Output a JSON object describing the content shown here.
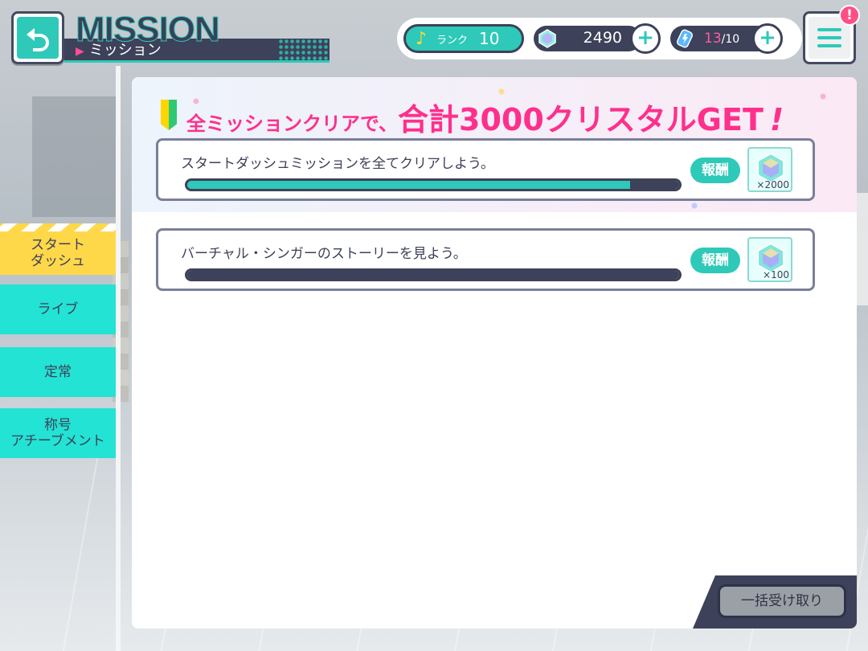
{
  "header": {
    "title": "MISSION",
    "subtitle": "ミッション",
    "back_icon": "back-arrow-icon",
    "menu_icon": "hamburger-menu-icon",
    "alert_badge": "!"
  },
  "status": {
    "rank_label": "ランク",
    "rank_value": "10",
    "crystals": "2490",
    "energy_current": "13",
    "energy_max": "/10",
    "add_symbol": "+"
  },
  "sidebar": {
    "tabs": [
      {
        "label_line1": "スタート",
        "label_line2": "ダッシュ",
        "active": true
      },
      {
        "label_line1": "ライブ",
        "label_line2": "",
        "active": false
      },
      {
        "label_line1": "定常",
        "label_line2": "",
        "active": false
      },
      {
        "label_line1": "称号",
        "label_line2": "アチーブメント",
        "active": false
      }
    ]
  },
  "banner": {
    "text_small": "全ミッションクリアで、",
    "text_large": "合計3000クリスタルGET",
    "text_excl": "!"
  },
  "missions": [
    {
      "description": "スタートダッシュミッションを全てクリアしよう。",
      "progress": 0.9,
      "reward_label": "報酬",
      "reward_qty": "×2000",
      "reward_icon": "crystal-icon"
    },
    {
      "description": "バーチャル・シンガーのストーリーを見よう。",
      "progress": 0.0,
      "reward_label": "報酬",
      "reward_qty": "×100",
      "reward_icon": "crystal-icon"
    }
  ],
  "footer": {
    "claim_all_label": "一括受け取り"
  },
  "colors": {
    "accent": "#2ec9b8",
    "navy": "#3d4159",
    "pink": "#ff2f8c",
    "active_tab": "#ffd84a"
  }
}
